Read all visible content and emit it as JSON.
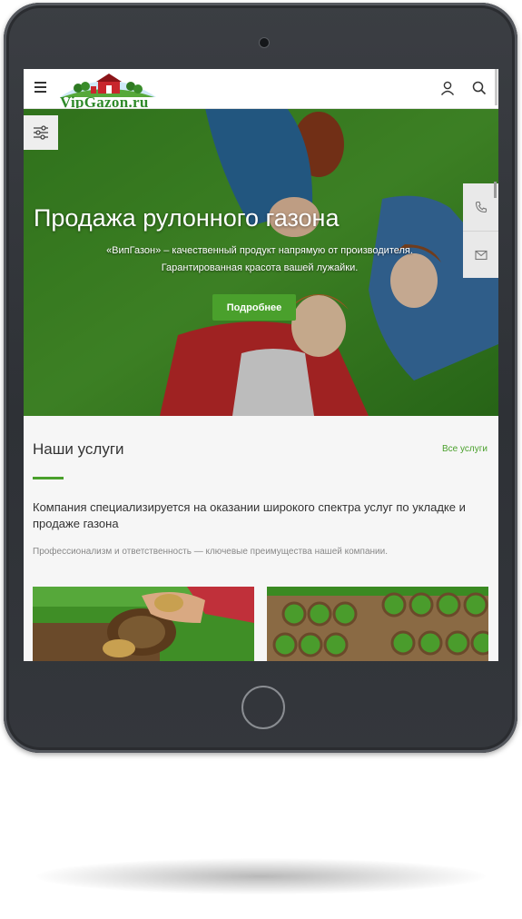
{
  "header": {
    "logo_text": "VipGazon.ru"
  },
  "hero": {
    "title": "Продажа рулонного газона",
    "text_line1": "«ВипГазон» – качественный продукт напрямую от производителя.",
    "text_line2": "Гарантированная красота вашей лужайки.",
    "button_label": "Подробнее"
  },
  "services": {
    "title": "Наши услуги",
    "all_link": "Все услуги",
    "description": "Компания специализируется на оказании широкого спектра услуг по укладке и продаже газона",
    "note": "Профессионализм и ответственность — ключевые преимущества нашей компании."
  },
  "icons": {
    "menu": "hamburger-icon",
    "user": "user-icon",
    "search": "search-icon",
    "filter": "sliders-icon",
    "phone": "phone-icon",
    "mail": "mail-icon"
  },
  "colors": {
    "accent": "#4aa02c",
    "device_frame": "#34373c",
    "page_bg": "#f6f6f6"
  }
}
